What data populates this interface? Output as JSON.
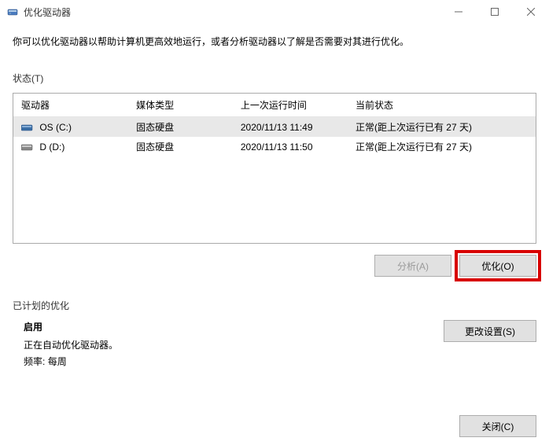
{
  "window": {
    "title": "优化驱动器"
  },
  "description": "你可以优化驱动器以帮助计算机更高效地运行，或者分析驱动器以了解是否需要对其进行优化。",
  "statusLabel": "状态(T)",
  "columns": {
    "drive": "驱动器",
    "media": "媒体类型",
    "lastRun": "上一次运行时间",
    "status": "当前状态"
  },
  "drives": [
    {
      "name": "OS (C:)",
      "media": "固态硬盘",
      "lastRun": "2020/11/13 11:49",
      "status": "正常(距上次运行已有 27 天)"
    },
    {
      "name": "D (D:)",
      "media": "固态硬盘",
      "lastRun": "2020/11/13 11:50",
      "status": "正常(距上次运行已有 27 天)"
    }
  ],
  "buttons": {
    "analyze": "分析(A)",
    "optimize": "优化(O)",
    "changeSettings": "更改设置(S)",
    "close": "关闭(C)"
  },
  "schedule": {
    "sectionLabel": "已计划的优化",
    "onLabel": "启用",
    "statusLine": "正在自动优化驱动器。",
    "freqLabel": "频率:",
    "freqValue": "每周"
  }
}
